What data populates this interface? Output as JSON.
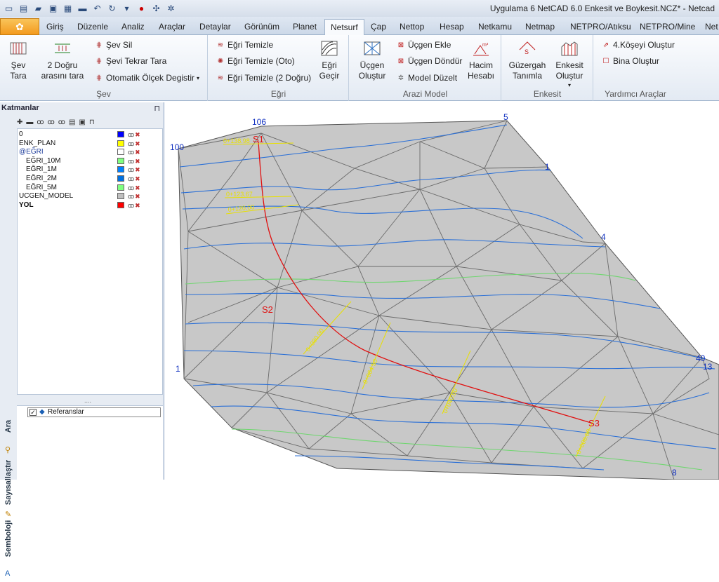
{
  "window": {
    "title": "Uygulama 6 NetCAD 6.0 Enkesit ve Boykesit.NCZ* - Netcad"
  },
  "qat": [
    "new-icon",
    "open-icon",
    "open-folder-icon",
    "save-icon",
    "print-icon",
    "folder-icon",
    "undo-icon",
    "redo-icon",
    "dropdown-icon",
    "separator-icon",
    "help-icon",
    "grid-icon",
    "settings-icon"
  ],
  "tabs": [
    "Giriş",
    "Düzenle",
    "Analiz",
    "Araçlar",
    "Detaylar",
    "Görünüm",
    "Planet",
    "Netsurf",
    "Çap",
    "Nettop",
    "Hesap",
    "Netkamu",
    "Netmap",
    "NETPRO/Atıksu",
    "NETPRO/Mine",
    "Net"
  ],
  "active_tab": "Netsurf",
  "ribbon": {
    "sev": {
      "label": "Şev",
      "sev_tara": "Şev\nTara",
      "iki_dogru": "2 Doğru\narasını tara",
      "sev_sil": "Şev Sil",
      "sev_tekrar": "Şevi Tekrar Tara",
      "otomatik": "Otomatik Ölçek Degistir"
    },
    "egri": {
      "label": "Eğri",
      "temizle": "Eğri Temizle",
      "temizle_oto": "Eğri Temizle (Oto)",
      "temizle_2": "Eğri Temizle (2 Doğru)",
      "gecir": "Eğri\nGeçir"
    },
    "arazi": {
      "label": "Arazi Model",
      "ucgen_olustur": "Üçgen\nOluştur",
      "ucgen_ekle": "Üçgen Ekle",
      "ucgen_dondur": "Üçgen Döndür",
      "model_duzelt": "Model Düzelt",
      "hacim": "Hacim\nHesabı"
    },
    "enkesit": {
      "label": "Enkesit",
      "guzergah": "Güzergah\nTanımla",
      "enkesit_olustur": "Enkesit\nOluştur"
    },
    "yardimci": {
      "label": "Yardımcı Araçlar",
      "kose": "4.Köşeyi Oluştur",
      "bina": "Bina Oluştur"
    }
  },
  "panel": {
    "title": "Katmanlar",
    "layers": [
      {
        "name": "0",
        "color": "#0000ff"
      },
      {
        "name": "ENK_PLAN",
        "color": "#ffff00"
      },
      {
        "name": "@EĞRI",
        "color": "#ffffff"
      },
      {
        "name": "EĞRI_10M",
        "color": "#80ff80"
      },
      {
        "name": "EĞRI_1M",
        "color": "#0080ff"
      },
      {
        "name": "EĞRI_2M",
        "color": "#0070e0"
      },
      {
        "name": "EĞRI_5M",
        "color": "#80ff80"
      },
      {
        "name": "UCGEN_MODEL",
        "color": "#c0c0c0"
      },
      {
        "name": "YOL",
        "color": "#ff0000"
      }
    ],
    "referans": "Referanslar",
    "side_tabs": [
      "Ara",
      "Sayısallaştır",
      "Semboloji"
    ]
  },
  "map": {
    "points": [
      "106",
      "5",
      "100",
      "1",
      "4",
      "40",
      "13",
      "8",
      "1"
    ],
    "stations": [
      "S1",
      "S2",
      "S3"
    ],
    "chainages": [
      "0+138.98",
      "0+123.67",
      "0+120.00",
      "0+080.00",
      "0+064.50",
      "0+040.00",
      "0+000.00"
    ]
  }
}
